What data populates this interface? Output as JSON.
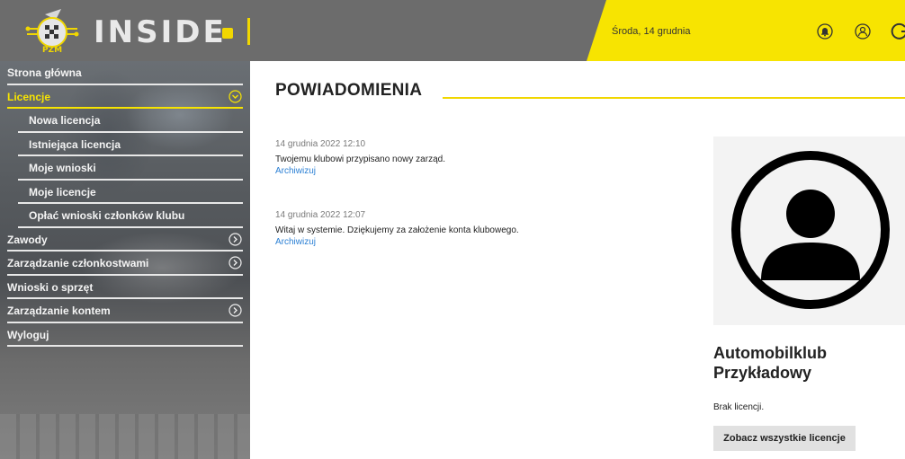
{
  "header": {
    "brand": "INSIDE",
    "logo_text": "PZM",
    "date": "Środa, 14 grudnia",
    "colors": {
      "header_bg": "#6c6c6c",
      "accent": "#f7e401"
    },
    "icons": [
      "bell-icon",
      "user-circle-icon",
      "refresh-icon"
    ]
  },
  "sidebar": {
    "items": [
      {
        "label": "Strona główna",
        "level": 0,
        "active": false,
        "chevron": false
      },
      {
        "label": "Licencje",
        "level": 0,
        "active": true,
        "chevron": "down"
      },
      {
        "label": "Nowa licencja",
        "level": 1,
        "active": false,
        "chevron": false
      },
      {
        "label": "Istniejąca licencja",
        "level": 1,
        "active": false,
        "chevron": false
      },
      {
        "label": "Moje wnioski",
        "level": 1,
        "active": false,
        "chevron": false
      },
      {
        "label": "Moje licencje",
        "level": 1,
        "active": false,
        "chevron": false
      },
      {
        "label": "Opłać wnioski członków klubu",
        "level": 1,
        "active": false,
        "chevron": false
      },
      {
        "label": "Zawody",
        "level": 0,
        "active": false,
        "chevron": "right"
      },
      {
        "label": "Zarządzanie członkostwami",
        "level": 0,
        "active": false,
        "chevron": "right"
      },
      {
        "label": "Wnioski o sprzęt",
        "level": 0,
        "active": false,
        "chevron": false
      },
      {
        "label": "Zarządzanie kontem",
        "level": 0,
        "active": false,
        "chevron": "right"
      },
      {
        "label": "Wyloguj",
        "level": 0,
        "active": false,
        "chevron": false
      }
    ]
  },
  "main": {
    "title": "POWIADOMIENIA",
    "notifications": [
      {
        "timestamp": "14 grudnia 2022 12:10",
        "message": "Twojemu klubowi przypisano nowy zarząd.",
        "action": "Archiwizuj"
      },
      {
        "timestamp": "14 grudnia 2022 12:07",
        "message": "Witaj w systemie. Dziękujemy za założenie konta klubowego.",
        "action": "Archiwizuj"
      }
    ]
  },
  "profile": {
    "club_name": "Automobilklub Przykładowy",
    "license_status": "Brak licencji.",
    "button_label": "Zobacz wszystkie licencje"
  }
}
